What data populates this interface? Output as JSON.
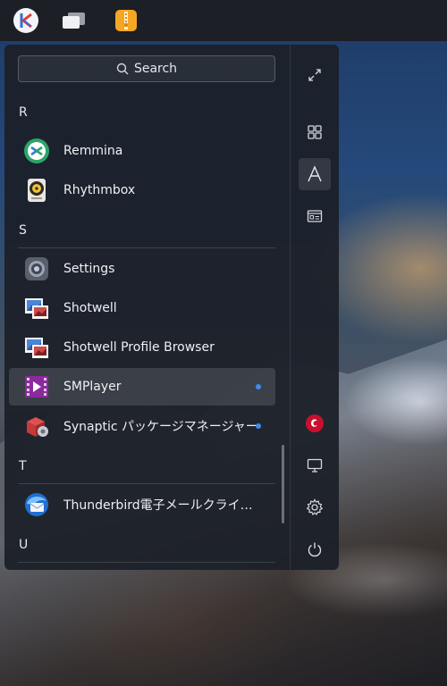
{
  "panel": {
    "items": [
      {
        "name": "launcher",
        "icon": "kylin-logo-icon"
      },
      {
        "name": "multitasking",
        "icon": "window-switch-icon"
      },
      {
        "name": "archive-manager",
        "icon": "archive-zip-icon"
      }
    ]
  },
  "launcher": {
    "search_label": "Search",
    "sections": [
      {
        "letter": "R"
      },
      {
        "letter": "S"
      },
      {
        "letter": "T"
      },
      {
        "letter": "U"
      }
    ],
    "apps": [
      {
        "label": "Remmina",
        "icon": "remmina-icon",
        "new": false
      },
      {
        "label": "Rhythmbox",
        "icon": "rhythmbox-icon",
        "new": false
      },
      {
        "label": "Settings",
        "icon": "settings-gear-icon",
        "new": false
      },
      {
        "label": "Shotwell",
        "icon": "shotwell-photo-icon",
        "new": false
      },
      {
        "label": "Shotwell Profile Browser",
        "icon": "shotwell-photo-icon",
        "new": false
      },
      {
        "label": "SMPlayer",
        "icon": "smplayer-icon",
        "new": true,
        "highlighted": true
      },
      {
        "label": "Synaptic パッケージマネージャー",
        "icon": "synaptic-package-icon",
        "new": true
      },
      {
        "label": "Thunderbird電子メールクライ…",
        "icon": "thunderbird-icon",
        "new": false
      }
    ],
    "sidebar": [
      {
        "name": "fullscreen",
        "icon": "expand-icon"
      },
      {
        "name": "category-view",
        "icon": "grid-icon"
      },
      {
        "name": "alphabetical-view",
        "icon": "letter-a-icon",
        "active": true
      },
      {
        "name": "function-view",
        "icon": "list-card-icon"
      },
      {
        "name": "debian",
        "icon": "debian-swirl-icon"
      },
      {
        "name": "computer",
        "icon": "monitor-icon"
      },
      {
        "name": "settings",
        "icon": "gear-icon"
      },
      {
        "name": "power",
        "icon": "power-icon"
      }
    ]
  },
  "colors": {
    "accent_dot": "#3d8eea",
    "launcher_bg": "#1c2028",
    "panel_bg": "#1c1f26"
  }
}
